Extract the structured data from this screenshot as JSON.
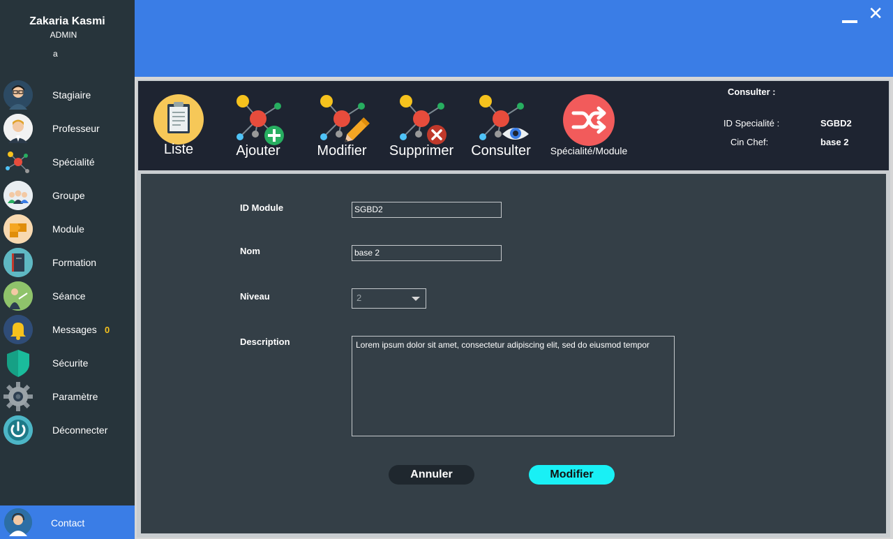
{
  "user": {
    "name": "Zakaria Kasmi",
    "role": "ADMIN",
    "extra": "a"
  },
  "sidebar": {
    "items": [
      {
        "label": "Stagiaire",
        "icon": "student-avatar-icon"
      },
      {
        "label": "Professeur",
        "icon": "professor-avatar-icon"
      },
      {
        "label": "Spécialité",
        "icon": "molecule-icon"
      },
      {
        "label": "Groupe",
        "icon": "group-people-icon"
      },
      {
        "label": "Module",
        "icon": "puzzle-icon"
      },
      {
        "label": "Formation",
        "icon": "book-icon"
      },
      {
        "label": "Séance",
        "icon": "teacher-board-icon"
      },
      {
        "label": "Messages",
        "icon": "bell-icon",
        "badge": "0"
      },
      {
        "label": "Sécurite",
        "icon": "shield-icon"
      },
      {
        "label": "Paramètre",
        "icon": "gear-icon"
      },
      {
        "label": "Déconnecter",
        "icon": "power-icon"
      }
    ],
    "contact": {
      "label": "Contact",
      "icon": "support-agent-icon"
    }
  },
  "toolbar": {
    "liste": "Liste",
    "ajouter": "Ajouter",
    "modifier": "Modifier",
    "supprimer": "Supprimer",
    "consulter": "Consulter",
    "specialite_module": "Spécialité/Module"
  },
  "consult_panel": {
    "title": "Consulter :",
    "id_label": "ID Specialité :",
    "id_value": "SGBD2",
    "cin_label": "Cin Chef:",
    "cin_value": "base 2"
  },
  "form": {
    "id_module_label": "ID Module",
    "id_module_value": "SGBD2",
    "nom_label": "Nom",
    "nom_value": "base 2",
    "niveau_label": "Niveau",
    "niveau_value": "2",
    "description_label": "Description",
    "description_value": "Lorem ipsum dolor sit amet, consectetur adipiscing elit, sed do eiusmod tempor",
    "cancel_label": "Annuler",
    "submit_label": "Modifier"
  },
  "colors": {
    "accent": "#3a7de6",
    "sidebar": "#27343b",
    "toolbar": "#1e2431",
    "content": "#343f47",
    "primary_button": "#19f0f5",
    "badge": "#f6c21d"
  }
}
